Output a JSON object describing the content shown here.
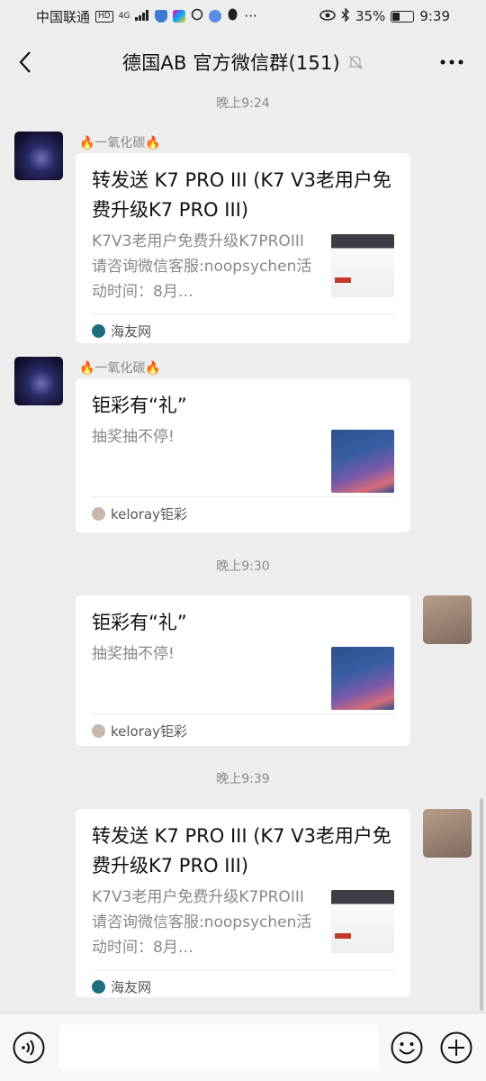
{
  "status_bar": {
    "carrier": "中国联通",
    "hd": "HD",
    "network": "4G",
    "battery": "35%",
    "battery_level": 0.35,
    "time": "9:39"
  },
  "title_bar": {
    "title": "德国AB  官方微信群(151)",
    "icons": [
      "back-icon",
      "mute-bell-icon",
      "more-icon"
    ]
  },
  "messages": [
    {
      "time": "晚上9:24",
      "sender": "🔥一氧化碳🔥",
      "card_title": "转发送 K7 PRO III (K7 V3老用户免费升级K7 PRO III)",
      "card_desc": "K7V3老用户免费升级K7PROIII请咨询微信客服:noopsychen活动时间：8月…",
      "source": "海友网"
    },
    {
      "sender": "🔥一氧化碳🔥",
      "card_title": "钜彩有“礼”",
      "card_desc": "抽奖抽不停!",
      "source": "keloray钜彩"
    },
    {
      "time": "晚上9:30",
      "card_title": "钜彩有“礼”",
      "card_desc": "抽奖抽不停!",
      "source": "keloray钜彩"
    },
    {
      "time": "晚上9:39",
      "card_title": "转发送 K7 PRO III (K7 V3老用户免费升级K7 PRO III)",
      "card_desc": "K7V3老用户免费升级K7PROIII请咨询微信客服:noopsychen活动时间：8月…",
      "source": "海友网"
    }
  ],
  "input_bar": {
    "icons": [
      "voice-icon",
      "emoji-icon",
      "plus-icon"
    ]
  }
}
